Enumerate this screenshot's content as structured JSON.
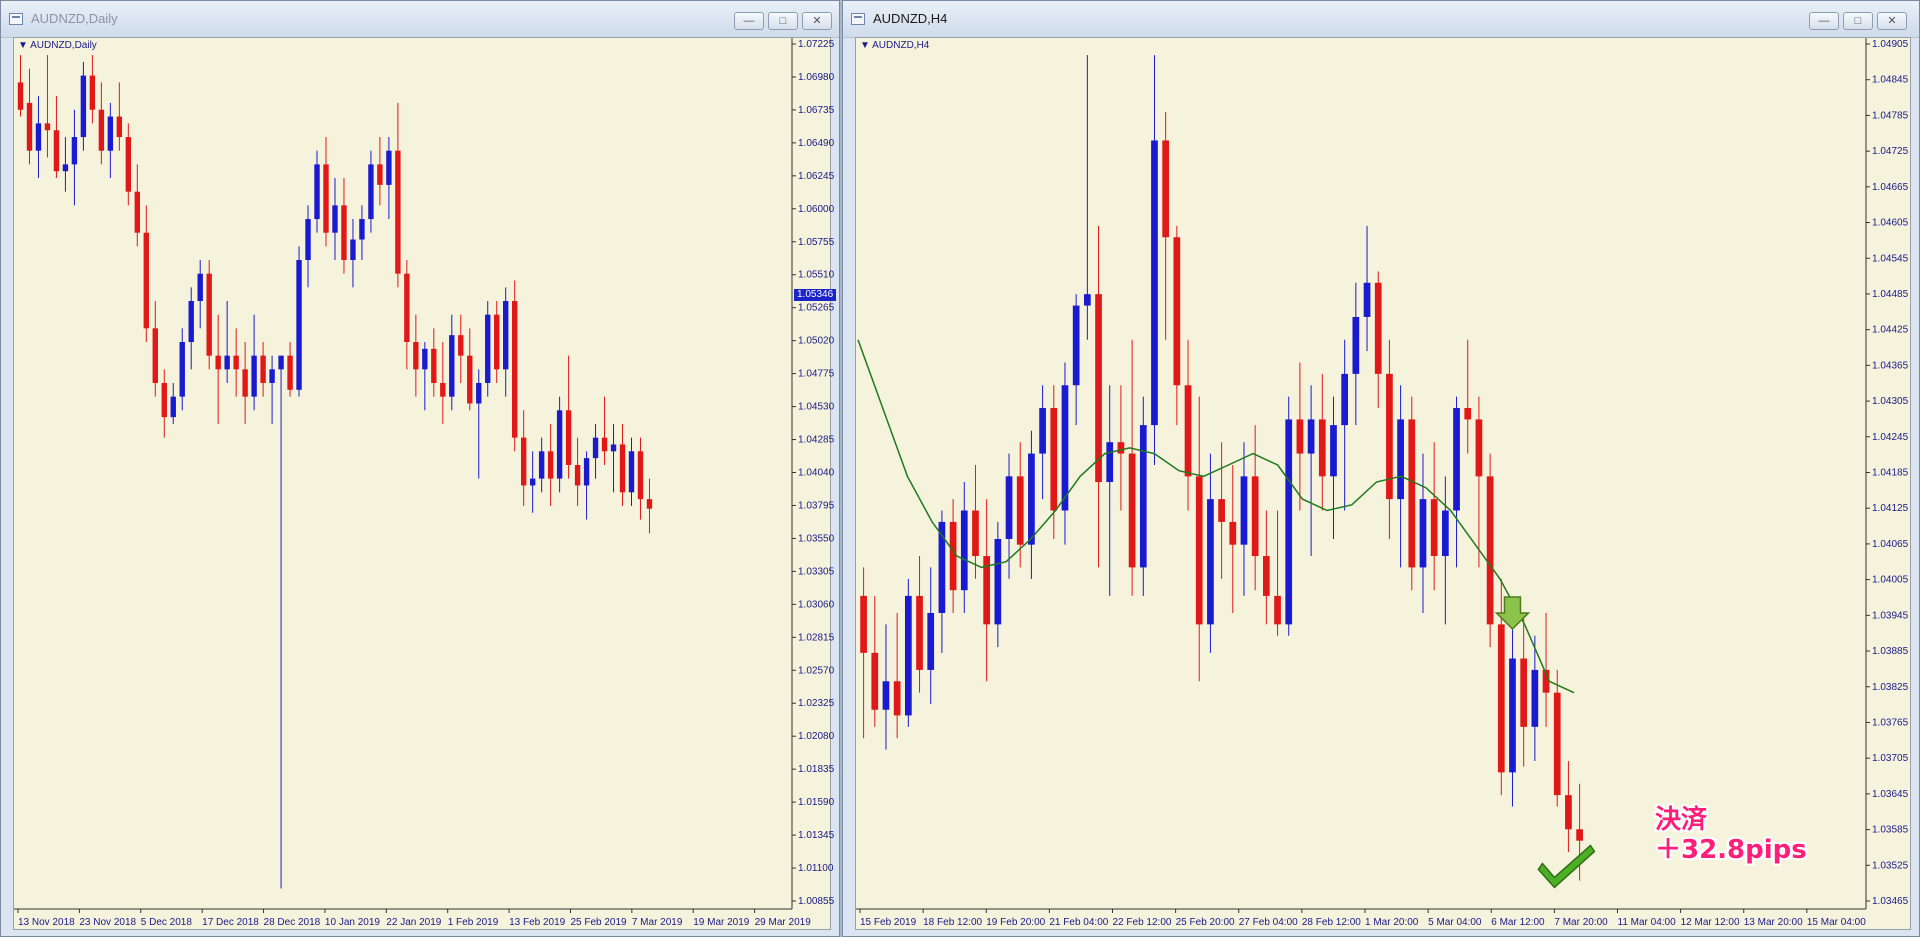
{
  "left_window": {
    "title": "AUDNZD,Daily",
    "buttons": {
      "minimize": "—",
      "maximize": "□",
      "close": "✕"
    },
    "symbol_label": "AUDNZD,Daily",
    "current_price": "1.05346",
    "chart_data": {
      "type": "candlestick",
      "ylim": [
        1.0085,
        1.07225
      ],
      "y_ticks": [
        "1.07225",
        "1.06980",
        "1.06735",
        "1.06490",
        "1.06245",
        "1.06000",
        "1.05755",
        "1.05510",
        "1.05265",
        "1.05020",
        "1.04775",
        "1.04530",
        "1.04285",
        "1.04040",
        "1.03795",
        "1.03550",
        "1.03305",
        "1.03060",
        "1.02815",
        "1.02570",
        "1.02325",
        "1.02080",
        "1.01835",
        "1.01590",
        "1.01345",
        "1.01100",
        "1.00855"
      ],
      "x_ticks": [
        "13 Nov 2018",
        "23 Nov 2018",
        "5 Dec 2018",
        "17 Dec 2018",
        "28 Dec 2018",
        "10 Jan 2019",
        "22 Jan 2019",
        "1 Feb 2019",
        "13 Feb 2019",
        "25 Feb 2019",
        "7 Mar 2019",
        "19 Mar 2019",
        "29 Mar 2019"
      ],
      "up_color": "#1a1ad0",
      "down_color": "#e01818",
      "candles": [
        [
          1.069,
          1.071,
          1.0665,
          1.067
        ],
        [
          1.0675,
          1.07,
          1.063,
          1.064
        ],
        [
          1.064,
          1.068,
          1.062,
          1.066
        ],
        [
          1.066,
          1.071,
          1.0635,
          1.0655
        ],
        [
          1.0655,
          1.068,
          1.062,
          1.0625
        ],
        [
          1.0625,
          1.065,
          1.061,
          1.063
        ],
        [
          1.063,
          1.067,
          1.06,
          1.065
        ],
        [
          1.065,
          1.0705,
          1.064,
          1.0695
        ],
        [
          1.0695,
          1.071,
          1.066,
          1.067
        ],
        [
          1.067,
          1.069,
          1.063,
          1.064
        ],
        [
          1.064,
          1.0675,
          1.062,
          1.0665
        ],
        [
          1.0665,
          1.069,
          1.064,
          1.065
        ],
        [
          1.065,
          1.066,
          1.06,
          1.061
        ],
        [
          1.061,
          1.063,
          1.057,
          1.058
        ],
        [
          1.058,
          1.06,
          1.05,
          1.051
        ],
        [
          1.051,
          1.053,
          1.046,
          1.047
        ],
        [
          1.047,
          1.048,
          1.043,
          1.0445
        ],
        [
          1.0445,
          1.047,
          1.044,
          1.046
        ],
        [
          1.046,
          1.051,
          1.045,
          1.05
        ],
        [
          1.05,
          1.054,
          1.048,
          1.053
        ],
        [
          1.053,
          1.056,
          1.051,
          1.055
        ],
        [
          1.055,
          1.056,
          1.048,
          1.049
        ],
        [
          1.049,
          1.052,
          1.044,
          1.048
        ],
        [
          1.048,
          1.053,
          1.047,
          1.049
        ],
        [
          1.049,
          1.051,
          1.046,
          1.048
        ],
        [
          1.048,
          1.05,
          1.044,
          1.046
        ],
        [
          1.046,
          1.052,
          1.045,
          1.049
        ],
        [
          1.049,
          1.05,
          1.046,
          1.047
        ],
        [
          1.047,
          1.049,
          1.044,
          1.048
        ],
        [
          1.048,
          1.049,
          1.01,
          1.049
        ],
        [
          1.049,
          1.05,
          1.046,
          1.0465
        ],
        [
          1.0465,
          1.057,
          1.046,
          1.056
        ],
        [
          1.056,
          1.06,
          1.054,
          1.059
        ],
        [
          1.059,
          1.064,
          1.058,
          1.063
        ],
        [
          1.063,
          1.065,
          1.057,
          1.058
        ],
        [
          1.058,
          1.062,
          1.056,
          1.06
        ],
        [
          1.06,
          1.062,
          1.055,
          1.056
        ],
        [
          1.056,
          1.059,
          1.054,
          1.0575
        ],
        [
          1.0575,
          1.06,
          1.056,
          1.059
        ],
        [
          1.059,
          1.064,
          1.058,
          1.063
        ],
        [
          1.063,
          1.065,
          1.06,
          1.0615
        ],
        [
          1.0615,
          1.065,
          1.059,
          1.064
        ],
        [
          1.064,
          1.0675,
          1.054,
          1.055
        ],
        [
          1.055,
          1.056,
          1.048,
          1.05
        ],
        [
          1.05,
          1.052,
          1.046,
          1.048
        ],
        [
          1.048,
          1.05,
          1.045,
          1.0495
        ],
        [
          1.0495,
          1.051,
          1.046,
          1.047
        ],
        [
          1.047,
          1.05,
          1.044,
          1.046
        ],
        [
          1.046,
          1.052,
          1.045,
          1.0505
        ],
        [
          1.0505,
          1.052,
          1.047,
          1.049
        ],
        [
          1.049,
          1.051,
          1.045,
          1.0455
        ],
        [
          1.0455,
          1.048,
          1.04,
          1.047
        ],
        [
          1.047,
          1.053,
          1.046,
          1.052
        ],
        [
          1.052,
          1.053,
          1.047,
          1.048
        ],
        [
          1.048,
          1.054,
          1.046,
          1.053
        ],
        [
          1.053,
          1.0545,
          1.042,
          1.043
        ],
        [
          1.043,
          1.045,
          1.038,
          1.0395
        ],
        [
          1.0395,
          1.042,
          1.0375,
          1.04
        ],
        [
          1.04,
          1.043,
          1.039,
          1.042
        ],
        [
          1.042,
          1.044,
          1.038,
          1.04
        ],
        [
          1.04,
          1.046,
          1.039,
          1.045
        ],
        [
          1.045,
          1.049,
          1.04,
          1.041
        ],
        [
          1.041,
          1.043,
          1.038,
          1.0395
        ],
        [
          1.0395,
          1.042,
          1.037,
          1.0415
        ],
        [
          1.0415,
          1.044,
          1.04,
          1.043
        ],
        [
          1.043,
          1.046,
          1.041,
          1.042
        ],
        [
          1.042,
          1.044,
          1.039,
          1.0425
        ],
        [
          1.0425,
          1.044,
          1.038,
          1.039
        ],
        [
          1.039,
          1.043,
          1.038,
          1.042
        ],
        [
          1.042,
          1.043,
          1.037,
          1.0385
        ],
        [
          1.0385,
          1.04,
          1.036,
          1.0378
        ]
      ]
    }
  },
  "right_window": {
    "title": "AUDNZD,H4",
    "buttons": {
      "minimize": "—",
      "maximize": "□",
      "close": "✕"
    },
    "symbol_label": "AUDNZD,H4",
    "chart_data": {
      "type": "candlestick",
      "ylim": [
        1.034,
        1.0493
      ],
      "y_ticks": [
        "1.04905",
        "1.04845",
        "1.04785",
        "1.04725",
        "1.04665",
        "1.04605",
        "1.04545",
        "1.04485",
        "1.04425",
        "1.04365",
        "1.04305",
        "1.04245",
        "1.04185",
        "1.04125",
        "1.04065",
        "1.04005",
        "1.03945",
        "1.03885",
        "1.03825",
        "1.03765",
        "1.03705",
        "1.03645",
        "1.03585",
        "1.03525",
        "1.03465"
      ],
      "x_ticks": [
        "15 Feb 2019",
        "18 Feb 12:00",
        "19 Feb 20:00",
        "21 Feb 04:00",
        "22 Feb 12:00",
        "25 Feb 20:00",
        "27 Feb 04:00",
        "28 Feb 12:00",
        "1 Mar 20:00",
        "5 Mar 04:00",
        "6 Mar 12:00",
        "7 Mar 20:00",
        "11 Mar 04:00",
        "12 Mar 12:00",
        "13 Mar 20:00",
        "15 Mar 04:00"
      ],
      "up_color": "#1a1ad0",
      "down_color": "#e01818",
      "ma_color": "#1f7a1f",
      "candles": [
        [
          1.0395,
          1.04,
          1.037,
          1.0385
        ],
        [
          1.0385,
          1.0395,
          1.0372,
          1.0375
        ],
        [
          1.0375,
          1.039,
          1.0368,
          1.038
        ],
        [
          1.038,
          1.0392,
          1.037,
          1.0374
        ],
        [
          1.0374,
          1.0398,
          1.0372,
          1.0395
        ],
        [
          1.0395,
          1.0402,
          1.0378,
          1.0382
        ],
        [
          1.0382,
          1.04,
          1.0376,
          1.0392
        ],
        [
          1.0392,
          1.041,
          1.0385,
          1.0408
        ],
        [
          1.0408,
          1.0412,
          1.0392,
          1.0396
        ],
        [
          1.0396,
          1.0415,
          1.0392,
          1.041
        ],
        [
          1.041,
          1.0418,
          1.0398,
          1.0402
        ],
        [
          1.0402,
          1.0412,
          1.038,
          1.039
        ],
        [
          1.039,
          1.0408,
          1.0386,
          1.0405
        ],
        [
          1.0405,
          1.042,
          1.0398,
          1.0416
        ],
        [
          1.0416,
          1.0422,
          1.04,
          1.0404
        ],
        [
          1.0404,
          1.0424,
          1.0398,
          1.042
        ],
        [
          1.042,
          1.0432,
          1.0412,
          1.0428
        ],
        [
          1.0428,
          1.0432,
          1.0405,
          1.041
        ],
        [
          1.041,
          1.0436,
          1.0404,
          1.0432
        ],
        [
          1.0432,
          1.0448,
          1.0425,
          1.0446
        ],
        [
          1.0446,
          1.049,
          1.044,
          1.0448
        ],
        [
          1.0448,
          1.046,
          1.04,
          1.0415
        ],
        [
          1.0415,
          1.0432,
          1.0395,
          1.0422
        ],
        [
          1.0422,
          1.0432,
          1.041,
          1.042
        ],
        [
          1.042,
          1.044,
          1.0395,
          1.04
        ],
        [
          1.04,
          1.043,
          1.0395,
          1.0425
        ],
        [
          1.0425,
          1.049,
          1.0418,
          1.0475
        ],
        [
          1.0475,
          1.048,
          1.044,
          1.0458
        ],
        [
          1.0458,
          1.046,
          1.0425,
          1.0432
        ],
        [
          1.0432,
          1.044,
          1.041,
          1.0416
        ],
        [
          1.0416,
          1.043,
          1.038,
          1.039
        ],
        [
          1.039,
          1.042,
          1.0385,
          1.0412
        ],
        [
          1.0412,
          1.0422,
          1.0398,
          1.0408
        ],
        [
          1.0408,
          1.0418,
          1.0392,
          1.0404
        ],
        [
          1.0404,
          1.0422,
          1.0395,
          1.0416
        ],
        [
          1.0416,
          1.0425,
          1.0396,
          1.0402
        ],
        [
          1.0402,
          1.041,
          1.039,
          1.0395
        ],
        [
          1.0395,
          1.041,
          1.0388,
          1.039
        ],
        [
          1.039,
          1.043,
          1.0388,
          1.0426
        ],
        [
          1.0426,
          1.0436,
          1.041,
          1.042
        ],
        [
          1.042,
          1.0432,
          1.0402,
          1.0426
        ],
        [
          1.0426,
          1.0434,
          1.041,
          1.0416
        ],
        [
          1.0416,
          1.043,
          1.0405,
          1.0425
        ],
        [
          1.0425,
          1.044,
          1.041,
          1.0434
        ],
        [
          1.0434,
          1.045,
          1.0425,
          1.0444
        ],
        [
          1.0444,
          1.046,
          1.0438,
          1.045
        ],
        [
          1.045,
          1.0452,
          1.0428,
          1.0434
        ],
        [
          1.0434,
          1.044,
          1.0405,
          1.0412
        ],
        [
          1.0412,
          1.0432,
          1.04,
          1.0426
        ],
        [
          1.0426,
          1.043,
          1.0396,
          1.04
        ],
        [
          1.04,
          1.042,
          1.0392,
          1.0412
        ],
        [
          1.0412,
          1.0422,
          1.0396,
          1.0402
        ],
        [
          1.0402,
          1.0416,
          1.039,
          1.041
        ],
        [
          1.041,
          1.043,
          1.04,
          1.0428
        ],
        [
          1.0428,
          1.044,
          1.042,
          1.0426
        ],
        [
          1.0426,
          1.043,
          1.04,
          1.0416
        ],
        [
          1.0416,
          1.042,
          1.0386,
          1.039
        ],
        [
          1.039,
          1.0398,
          1.036,
          1.0364
        ],
        [
          1.0364,
          1.039,
          1.0358,
          1.0384
        ],
        [
          1.0384,
          1.0392,
          1.0365,
          1.0372
        ],
        [
          1.0372,
          1.0388,
          1.0366,
          1.0382
        ],
        [
          1.0382,
          1.0392,
          1.0372,
          1.0378
        ],
        [
          1.0378,
          1.0382,
          1.0358,
          1.036
        ],
        [
          1.036,
          1.0366,
          1.035,
          1.0354
        ],
        [
          1.0354,
          1.0362,
          1.0345,
          1.0352
        ]
      ],
      "ma": [
        1.044,
        1.0428,
        1.0416,
        1.0408,
        1.0402,
        1.04,
        1.0401,
        1.0405,
        1.041,
        1.0416,
        1.042,
        1.0421,
        1.042,
        1.0417,
        1.0416,
        1.0418,
        1.042,
        1.0418,
        1.0412,
        1.041,
        1.0411,
        1.0415,
        1.0416,
        1.0414,
        1.041,
        1.0404,
        1.0398,
        1.039,
        1.038,
        1.0378
      ]
    }
  },
  "overlay": {
    "line1": "決済",
    "line2": "＋32.8pips"
  }
}
